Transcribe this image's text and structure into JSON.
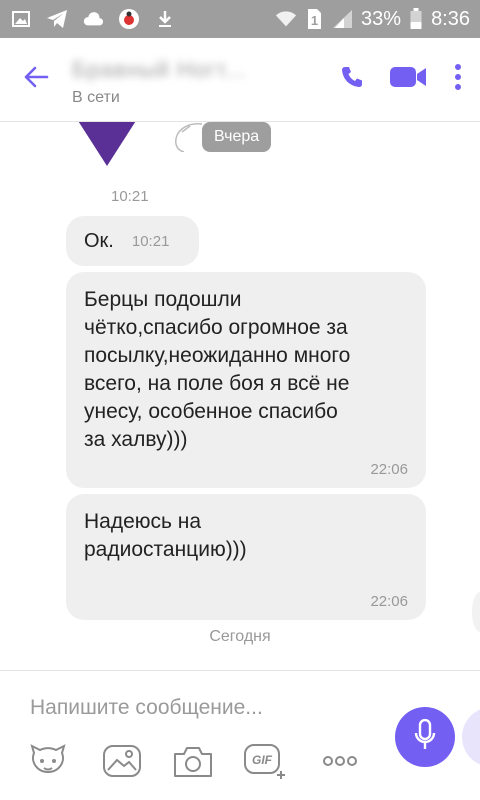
{
  "status_bar": {
    "battery_percent": "33%",
    "time": "8:36",
    "sim_label": "1",
    "icons": [
      "gallery-icon",
      "telegram-icon",
      "cloud-icon",
      "ladybug-app-icon",
      "download-icon",
      "wifi-icon",
      "sim-icon",
      "signal-icon",
      "battery-icon"
    ]
  },
  "header": {
    "contact_name": "Бравный Ногт...",
    "contact_status": "В сети",
    "icons": [
      "back-arrow-icon",
      "phone-icon",
      "video-camera-icon",
      "more-vertical-icon"
    ],
    "accent_color": "#7360f2"
  },
  "chat": {
    "sticker_day_label": "Вчера",
    "sticker_time": "10:21",
    "messages": [
      {
        "text": "Ок.",
        "time": "10:21"
      },
      {
        "text": "Берцы подошли\nчётко,спасибо огромное за\nпосылку,неожиданно много\nвсего, на поле боя я всё не\nунесу, особенное спасибо\nза халву)))",
        "time": "22:06"
      },
      {
        "text": "Надеюсь на\nрадиостанцию)))",
        "time": "22:06"
      }
    ],
    "today_label": "Сегодня",
    "bubble_color": "#efefef"
  },
  "composer": {
    "placeholder": "Напишите сообщение...",
    "value": "",
    "mic_color": "#7360f2",
    "tools": [
      "sticker-icon",
      "gallery-icon",
      "camera-icon",
      "gif-icon",
      "more-horizontal-icon"
    ],
    "gif_label": "GIF"
  }
}
